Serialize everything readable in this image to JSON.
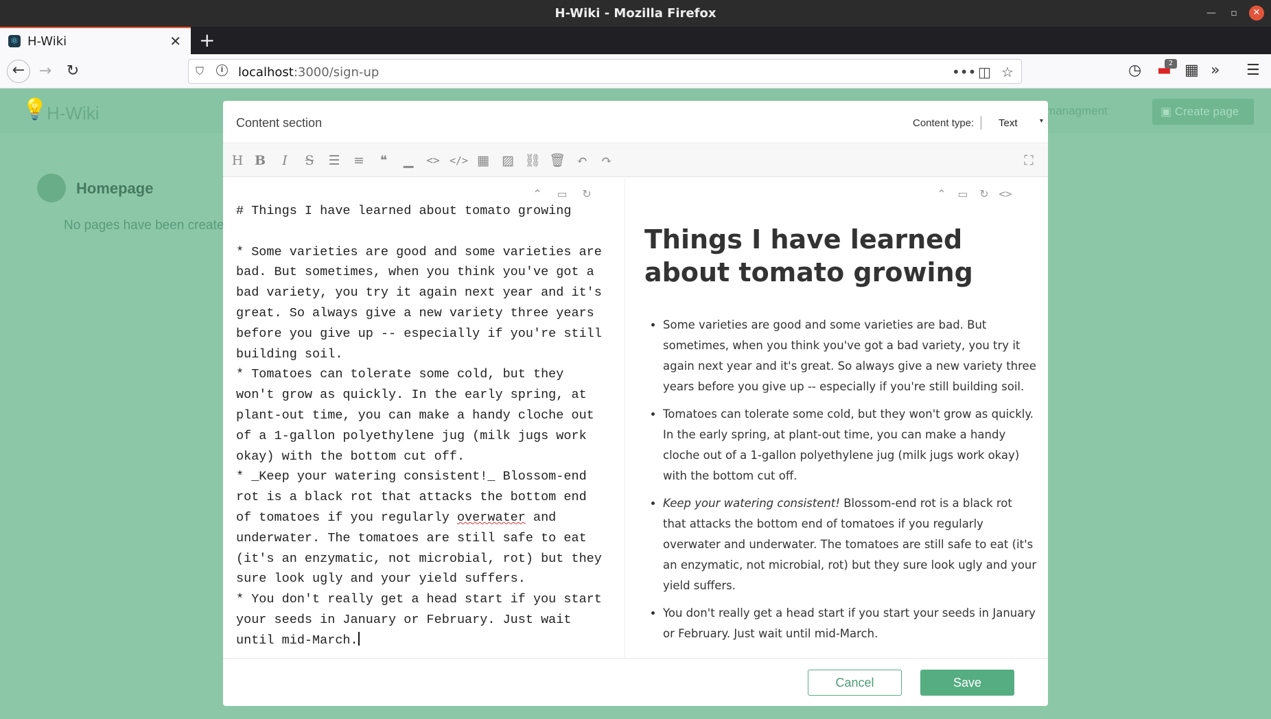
{
  "window": {
    "title": "H-Wiki - Mozilla Firefox"
  },
  "tab": {
    "label": "H-Wiki"
  },
  "navbar": {
    "url_host": "localhost",
    "url_path": ":3000/sign-up",
    "notif_count": "2"
  },
  "app": {
    "name": "H-Wiki",
    "nav_managment": "managment",
    "create_page": "Create page",
    "homepage": "Homepage",
    "no_pages": "No pages have been create"
  },
  "modal": {
    "title": "Content section",
    "content_type_label": "Content type:",
    "content_type_value": "Text",
    "editor_lines": [
      "# Things I have learned about tomato growing",
      "",
      "* Some varieties are good and some varieties are bad. But sometimes, when you think you've got a bad variety, you try it again next year and it's great. So always give a new variety three years before you give up -- especially if you're still building soil.",
      "* Tomatoes can tolerate some cold, but they won't grow as quickly. In the early spring, at plant-out time, you can make a handy cloche out of a 1-gallon polyethylene jug (milk jugs work okay) with the bottom cut off.",
      "* _Keep your watering consistent!_ Blossom-end rot is a black rot that attacks the bottom end of tomatoes if you regularly ",
      "overwater",
      " and underwater. The tomatoes are still safe to eat (it's an enzymatic, not microbial, rot) but they sure look ugly and your yield suffers.",
      "* You don't really get a head start if you start your seeds in January or February. Just wait until mid-March."
    ],
    "preview": {
      "title": "Things I have learned about tomato growing",
      "items": [
        "Some varieties are good and some varieties are bad. But sometimes, when you think you've got a bad variety, you try it again next year and it's great. So always give a new variety three years before you give up -- especially if you're still building soil.",
        "Tomatoes can tolerate some cold, but they won't grow as quickly. In the early spring, at plant-out time, you can make a handy cloche out of a 1-gallon polyethylene jug (milk jugs work okay) with the bottom cut off.",
        "Blossom-end rot is a black rot that attacks the bottom end of tomatoes if you regularly overwater and underwater. The tomatoes are still safe to eat (it's an enzymatic, not microbial, rot) but they sure look ugly and your yield suffers.",
        "You don't really get a head start if you start your seeds in January or February. Just wait until mid-March."
      ],
      "item3_emphasis": "Keep your watering consistent!"
    },
    "cancel_label": "Cancel",
    "save_label": "Save"
  }
}
